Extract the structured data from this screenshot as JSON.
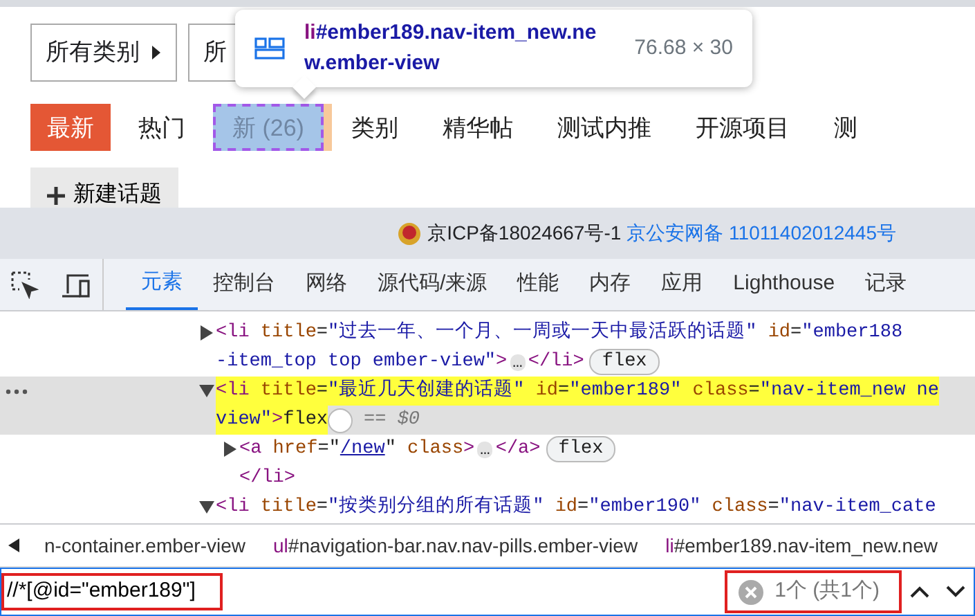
{
  "page": {
    "filters": [
      {
        "label": "所有类别",
        "caret": true
      },
      {
        "label": "所",
        "caret": false
      }
    ],
    "nav": [
      {
        "label": "最新",
        "selected": true,
        "inspected": false
      },
      {
        "label": "热门",
        "selected": false,
        "inspected": false
      },
      {
        "label": "新 (26)",
        "selected": false,
        "inspected": true
      },
      {
        "label": "类别",
        "selected": false,
        "inspected": false
      },
      {
        "label": "精华帖",
        "selected": false,
        "inspected": false
      },
      {
        "label": "测试内推",
        "selected": false,
        "inspected": false
      },
      {
        "label": "开源项目",
        "selected": false,
        "inspected": false
      },
      {
        "label": "测",
        "selected": false,
        "inspected": false
      }
    ],
    "new_topic": "新建话题",
    "tooltip": {
      "tag": "li",
      "selector": "#ember189.nav-item_new.new.ember-view",
      "size": "76.68 × 30"
    }
  },
  "footer": {
    "icp": "京ICP备18024667号-1",
    "police": "京公安网备 11011402012445号"
  },
  "devtools": {
    "tabs": [
      {
        "label": "元素",
        "selected": true
      },
      {
        "label": "控制台",
        "selected": false
      },
      {
        "label": "网络",
        "selected": false
      },
      {
        "label": "源代码/来源",
        "selected": false
      },
      {
        "label": "性能",
        "selected": false
      },
      {
        "label": "内存",
        "selected": false
      },
      {
        "label": "应用",
        "selected": false
      },
      {
        "label": "Lighthouse",
        "selected": false
      },
      {
        "label": "记录",
        "selected": false
      }
    ],
    "tree": [
      {
        "kind": "element",
        "expanded": false,
        "search_match": false,
        "rows": [
          {
            "tokens": [
              {
                "kind": "tag",
                "text": "<li"
              },
              {
                "kind": "attr",
                "text": " title"
              },
              {
                "kind": "punct",
                "text": "="
              },
              {
                "kind": "value",
                "text": "\"过去一年、一个月、一周或一天中最活跃的话题\""
              },
              {
                "kind": "attr",
                "text": " id"
              },
              {
                "kind": "punct",
                "text": "="
              },
              {
                "kind": "value",
                "text": "\"ember188"
              }
            ]
          },
          {
            "tokens": [
              {
                "kind": "value",
                "text": "-item_top top ember-view\""
              },
              {
                "kind": "tag",
                "text": ">"
              },
              {
                "kind": "ellipsis",
                "text": "…"
              },
              {
                "kind": "tag",
                "text": "</li>"
              },
              {
                "kind": "badge",
                "text": "flex"
              }
            ]
          }
        ]
      },
      {
        "kind": "element",
        "expanded": true,
        "search_match": true,
        "rows": [
          {
            "tokens": [
              {
                "kind": "tag",
                "text": "<li"
              },
              {
                "kind": "attr",
                "text": " title"
              },
              {
                "kind": "punct",
                "text": "="
              },
              {
                "kind": "value",
                "text": "\"最近几天创建的话题\""
              },
              {
                "kind": "attr",
                "text": " id"
              },
              {
                "kind": "punct",
                "text": "="
              },
              {
                "kind": "value",
                "text": "\"ember189\""
              },
              {
                "kind": "attr",
                "text": " class"
              },
              {
                "kind": "punct",
                "text": "="
              },
              {
                "kind": "value",
                "text": "\"nav-item_new ne"
              }
            ]
          },
          {
            "tokens": [
              {
                "kind": "value",
                "text": "view\""
              },
              {
                "kind": "tag",
                "text": ">"
              },
              {
                "kind": "text",
                "text": "flex"
              },
              {
                "kind": "circle"
              },
              {
                "kind": "note",
                "text": "== $0"
              }
            ]
          }
        ],
        "children": [
          {
            "kind": "element",
            "expanded": false,
            "search_match": false,
            "rows": [
              {
                "tokens": [
                  {
                    "kind": "tag",
                    "text": "<a"
                  },
                  {
                    "kind": "attr",
                    "text": " href"
                  },
                  {
                    "kind": "punct",
                    "text": "=\""
                  },
                  {
                    "kind": "link",
                    "text": "/new"
                  },
                  {
                    "kind": "punct",
                    "text": "\""
                  },
                  {
                    "kind": "attr",
                    "text": " class"
                  },
                  {
                    "kind": "tag",
                    "text": ">"
                  },
                  {
                    "kind": "ellipsis",
                    "text": "…"
                  },
                  {
                    "kind": "tag",
                    "text": "</a>"
                  },
                  {
                    "kind": "badge",
                    "text": "flex"
                  }
                ]
              }
            ]
          },
          {
            "kind": "closing",
            "rows": [
              {
                "tokens": [
                  {
                    "kind": "tag",
                    "text": "</li>"
                  }
                ]
              }
            ]
          }
        ]
      },
      {
        "kind": "element",
        "expanded": true,
        "search_match": false,
        "rows": [
          {
            "tokens": [
              {
                "kind": "tag",
                "text": "<li"
              },
              {
                "kind": "attr",
                "text": " title"
              },
              {
                "kind": "punct",
                "text": "="
              },
              {
                "kind": "value",
                "text": "\"按类别分组的所有话题\""
              },
              {
                "kind": "attr",
                "text": " id"
              },
              {
                "kind": "punct",
                "text": "="
              },
              {
                "kind": "value",
                "text": "\"ember190\""
              },
              {
                "kind": "attr",
                "text": " class"
              },
              {
                "kind": "punct",
                "text": "="
              },
              {
                "kind": "value",
                "text": "\"nav-item_cate"
              }
            ]
          }
        ]
      }
    ],
    "breadcrumbs": [
      {
        "rest": "n-container.ember-view"
      },
      {
        "tag": "ul",
        "rest": "#navigation-bar.nav.nav-pills.ember-view"
      },
      {
        "tag": "li",
        "rest": "#ember189.nav-item_new.new"
      }
    ],
    "search": {
      "value": "//*[@id=\"ember189\"]",
      "result": "1个 (共1个)",
      "annotated": true
    }
  }
}
